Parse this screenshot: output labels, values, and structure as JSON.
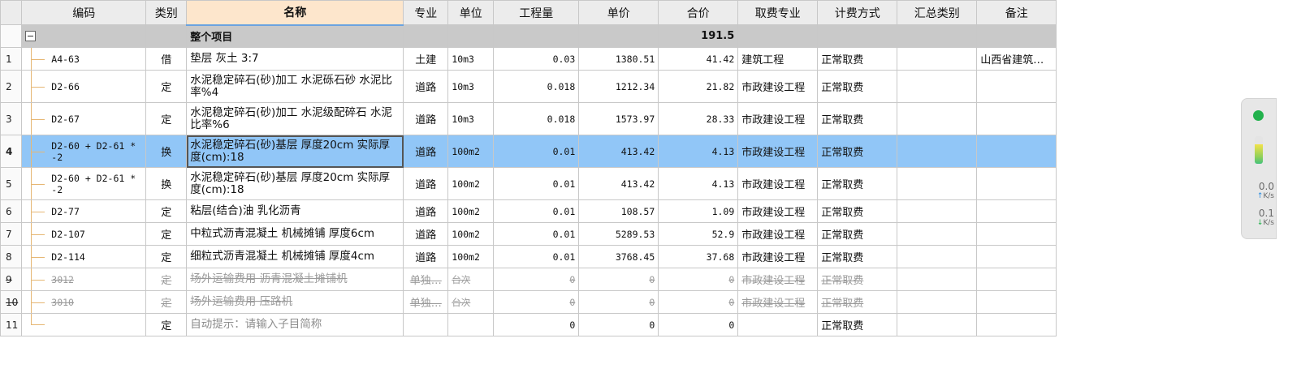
{
  "columns": {
    "code": "编码",
    "type": "类别",
    "name": "名称",
    "major": "专业",
    "unit": "单位",
    "qty": "工程量",
    "price": "单价",
    "total": "合价",
    "fee_major": "取费专业",
    "fee_mode": "计费方式",
    "summary": "汇总类别",
    "remark": "备注"
  },
  "project": {
    "label": "整个项目",
    "total": "191.5"
  },
  "rows": [
    {
      "n": "1",
      "code": "A4-63",
      "type": "借",
      "name": "垫层 灰土 3:7",
      "major": "土建",
      "unit": "10m3",
      "qty": "0.03",
      "price": "1380.51",
      "total": "41.42",
      "fee_major": "建筑工程",
      "fee_mode": "正常取费",
      "summary": "",
      "remark": "山西省建筑…"
    },
    {
      "n": "2",
      "code": "D2-66",
      "type": "定",
      "name": "水泥稳定碎石(砂)加工 水泥砾石砂 水泥比率%4",
      "major": "道路",
      "unit": "10m3",
      "qty": "0.018",
      "price": "1212.34",
      "total": "21.82",
      "fee_major": "市政建设工程",
      "fee_mode": "正常取费",
      "summary": "",
      "remark": ""
    },
    {
      "n": "3",
      "code": "D2-67",
      "type": "定",
      "name": "水泥稳定碎石(砂)加工 水泥级配碎石 水泥比率%6",
      "major": "道路",
      "unit": "10m3",
      "qty": "0.018",
      "price": "1573.97",
      "total": "28.33",
      "fee_major": "市政建设工程",
      "fee_mode": "正常取费",
      "summary": "",
      "remark": ""
    },
    {
      "n": "4",
      "code": "D2-60 + D2-61 * -2",
      "type": "换",
      "name": "水泥稳定碎石(砂)基层 厚度20cm  实际厚度(cm):18",
      "major": "道路",
      "unit": "100m2",
      "qty": "0.01",
      "price": "413.42",
      "total": "4.13",
      "fee_major": "市政建设工程",
      "fee_mode": "正常取费",
      "summary": "",
      "remark": ""
    },
    {
      "n": "5",
      "code": "D2-60 + D2-61 * -2",
      "type": "换",
      "name": "水泥稳定碎石(砂)基层 厚度20cm  实际厚度(cm):18",
      "major": "道路",
      "unit": "100m2",
      "qty": "0.01",
      "price": "413.42",
      "total": "4.13",
      "fee_major": "市政建设工程",
      "fee_mode": "正常取费",
      "summary": "",
      "remark": ""
    },
    {
      "n": "6",
      "code": "D2-77",
      "type": "定",
      "name": "粘层(结合)油 乳化沥青",
      "major": "道路",
      "unit": "100m2",
      "qty": "0.01",
      "price": "108.57",
      "total": "1.09",
      "fee_major": "市政建设工程",
      "fee_mode": "正常取费",
      "summary": "",
      "remark": ""
    },
    {
      "n": "7",
      "code": "D2-107",
      "type": "定",
      "name": "中粒式沥青混凝土 机械摊铺 厚度6cm",
      "major": "道路",
      "unit": "100m2",
      "qty": "0.01",
      "price": "5289.53",
      "total": "52.9",
      "fee_major": "市政建设工程",
      "fee_mode": "正常取费",
      "summary": "",
      "remark": ""
    },
    {
      "n": "8",
      "code": "D2-114",
      "type": "定",
      "name": "细粒式沥青混凝土 机械摊铺 厚度4cm",
      "major": "道路",
      "unit": "100m2",
      "qty": "0.01",
      "price": "3768.45",
      "total": "37.68",
      "fee_major": "市政建设工程",
      "fee_mode": "正常取费",
      "summary": "",
      "remark": ""
    },
    {
      "n": "9",
      "code": "3012",
      "type": "定",
      "name": "场外运输费用 沥青混凝土摊铺机",
      "major": "单独…",
      "unit": "台次",
      "qty": "0",
      "price": "0",
      "total": "0",
      "fee_major": "市政建设工程",
      "fee_mode": "正常取费",
      "summary": "",
      "remark": ""
    },
    {
      "n": "10",
      "code": "3010",
      "type": "定",
      "name": "场外运输费用 压路机",
      "major": "单独…",
      "unit": "台次",
      "qty": "0",
      "price": "0",
      "total": "0",
      "fee_major": "市政建设工程",
      "fee_mode": "正常取费",
      "summary": "",
      "remark": ""
    },
    {
      "n": "11",
      "code": "",
      "type": "定",
      "name": "自动提示：请输入子目简称",
      "major": "",
      "unit": "",
      "qty": "0",
      "price": "0",
      "total": "0",
      "fee_major": "",
      "fee_mode": "正常取费",
      "summary": "",
      "remark": ""
    }
  ],
  "widget": {
    "upload": "0.0",
    "download": "0.1",
    "unit": "K/s"
  }
}
